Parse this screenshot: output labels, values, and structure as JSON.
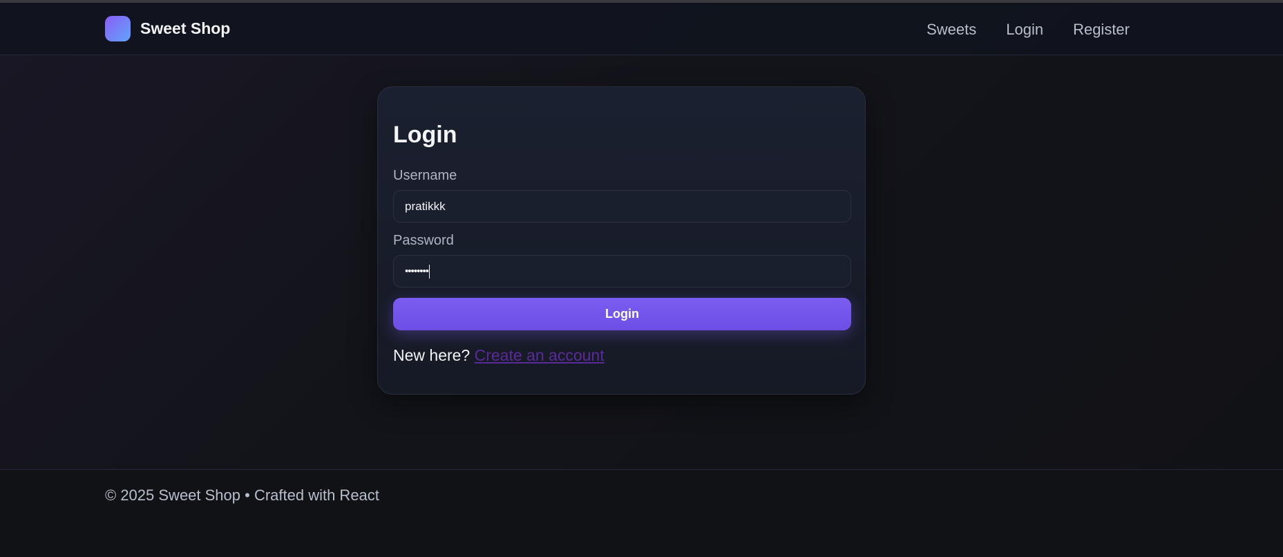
{
  "navbar": {
    "brand": "Sweet Shop",
    "links": [
      "Sweets",
      "Login",
      "Register"
    ]
  },
  "login_card": {
    "title": "Login",
    "username_label": "Username",
    "username_value": "pratikkk",
    "password_label": "Password",
    "password_masked": "••••••••",
    "submit_label": "Login",
    "signup_prompt": "New here?",
    "signup_link": "Create an account"
  },
  "footer": {
    "text": "© 2025 Sweet Shop • Crafted with React"
  },
  "colors": {
    "accent": "#7c5cf0",
    "background": "#13141a",
    "card": "#1b2030",
    "link": "#5b2a9a"
  }
}
